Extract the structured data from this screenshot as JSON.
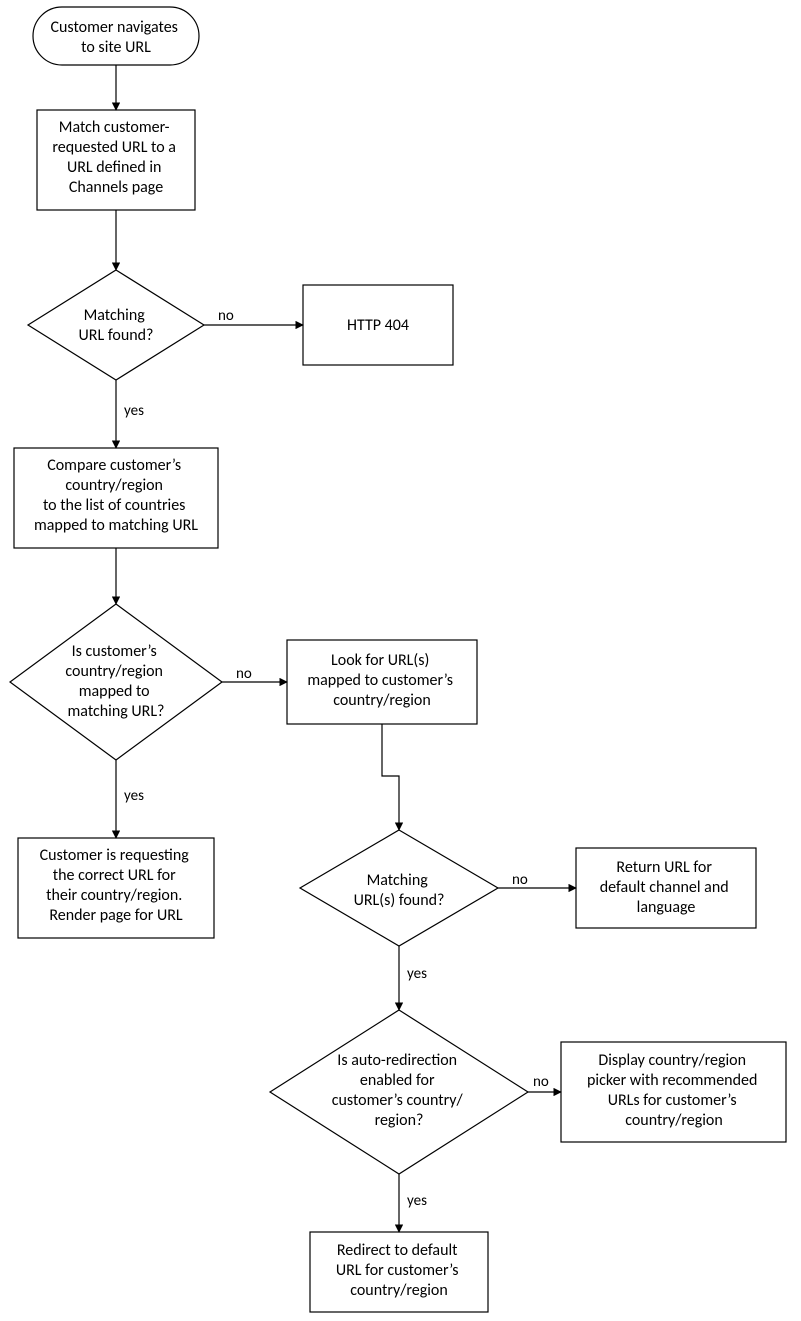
{
  "nodes": {
    "start": {
      "l1": "Customer navigates",
      "l2": "to site URL"
    },
    "match": {
      "l1": "Match customer-",
      "l2": "requested URL to a",
      "l3": "URL defined in",
      "l4": "Channels page"
    },
    "d1": {
      "l1": "Matching",
      "l2": "URL found?"
    },
    "http404": {
      "l1": "HTTP 404"
    },
    "compare": {
      "l1": "Compare customer’s",
      "l2": "country/region",
      "l3": "to the list of countries",
      "l4": "mapped to matching URL"
    },
    "d2": {
      "l1": "Is customer’s",
      "l2": "country/region",
      "l3": "mapped to",
      "l4": "matching URL?"
    },
    "lookurl": {
      "l1": "Look for URL(s)",
      "l2": "mapped to customer’s",
      "l3": "country/region"
    },
    "render": {
      "l1": "Customer is requesting",
      "l2": "the correct URL for",
      "l3": "their country/region.",
      "l4": "Render page for URL"
    },
    "d3": {
      "l1": "Matching",
      "l2": "URL(s) found?"
    },
    "retdef": {
      "l1": "Return URL for",
      "l2": "default channel and",
      "l3": "language"
    },
    "d4": {
      "l1": "Is auto-redirection",
      "l2": "enabled for",
      "l3": "customer’s country/",
      "l4": "region?"
    },
    "display": {
      "l1": "Display country/region",
      "l2": "picker with recommended",
      "l3": "URLs for customer’s",
      "l4": "country/region"
    },
    "redirect": {
      "l1": "Redirect to default",
      "l2": "URL for customer’s",
      "l3": "country/region"
    }
  },
  "edge": {
    "yes": "yes",
    "no": "no"
  }
}
